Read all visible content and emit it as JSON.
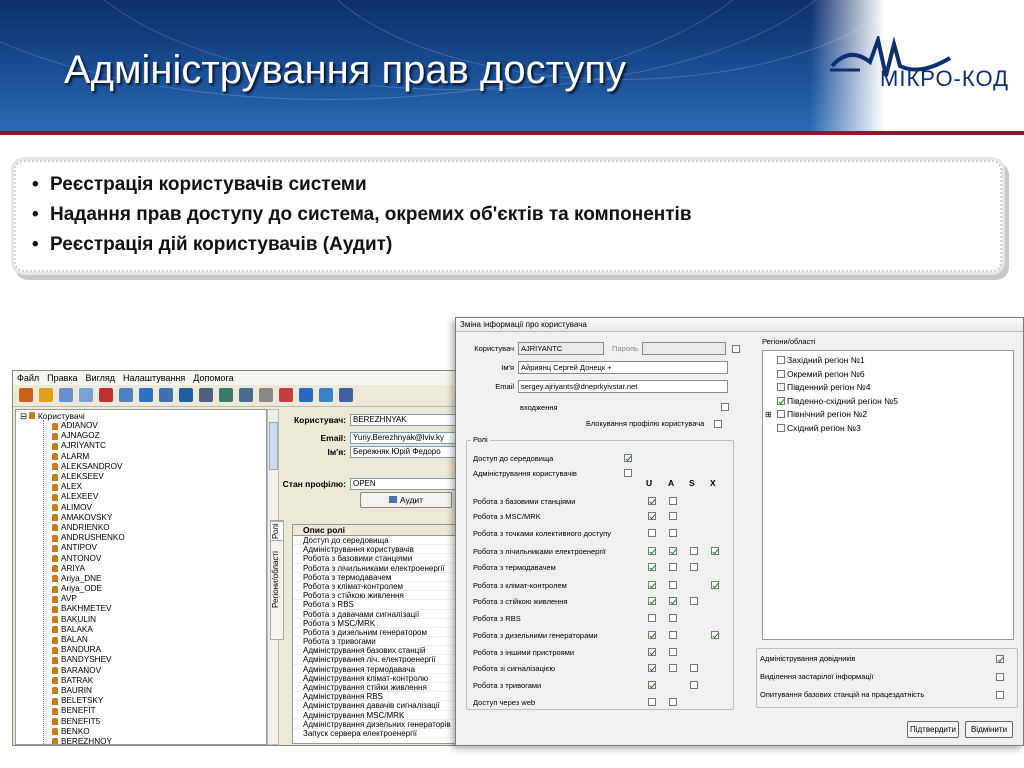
{
  "slide": {
    "title": "Адміністрування прав доступу",
    "logo_text": "МІКРО-КОД",
    "bullets": [
      "Реєстрація користувачів системи",
      "Надання прав доступу до система, окремих об'єктів та компонентів",
      "Реєстрація дій користувачів (Аудит)"
    ]
  },
  "main_window": {
    "menu": [
      "Файл",
      "Правка",
      "Вигляд",
      "Налаштування",
      "Допомога"
    ],
    "tree_root": "Користувачі",
    "users": [
      "ADIANOV",
      "AJNAGOZ",
      "AJRIYANTC",
      "ALARM",
      "ALEKSANDROV",
      "ALEKSEEV",
      "ALEX",
      "ALEXEEV",
      "ALIMOV",
      "AMAKOVSKY",
      "ANDRIENKO",
      "ANDRUSHENKO",
      "ANTIPOV",
      "ANTONOV",
      "ARIYA",
      "Ariya_DNE",
      "Ariya_ODE",
      "AVP",
      "BAKHMETEV",
      "BAKULIN",
      "BALAKA",
      "BALAN",
      "BANDURA",
      "BANDYSHEV",
      "BARANOV",
      "BATRAK",
      "BAURIN",
      "BELETSKY",
      "BENEFIT",
      "BENEFIT5",
      "BENKO",
      "BEREZHNOY"
    ],
    "form": {
      "user_label": "Користувач:",
      "user_value": "BEREZHNYAK",
      "email_label": "Email:",
      "email_value": "Yuriy.Berezhnyak@lviv.ky",
      "name_label": "Ім'я:",
      "name_value": "Бережняк Юрій Федоро",
      "profile_label": "Стан профілю:",
      "profile_value": "OPEN",
      "audit_button": "Аудит"
    },
    "tab_roles": "Ролі",
    "tab_regions": "Регіони/області",
    "roles_header": "Опис ролі",
    "roles": [
      "Доступ до середовища",
      "Адміністрування користувачів",
      "Робота з базовими станціями",
      "Робота з лічильниками електроенергії",
      "Робота з термодавачем",
      "Робота з клімат-контролем",
      "Робота з стійкою живлення",
      "Робота з RBS",
      "Робота з давачами сигналізації",
      "Робота з MSC/MRK",
      "Робота з дизельним генератором",
      "Робота з тривогами",
      "Адміністрування базових станцій",
      "Адміністрування ліч. електроенергії",
      "Адміністрування термодавача",
      "Адміністрування клімат-контролю",
      "Адміністрування стійки живлення",
      "Адміністрування RBS",
      "Адміністрування давачів сигналізації",
      "Адміністрування MSC/MRK",
      "Адміністрування дизельних генераторів",
      "Запуск сервера електроенергії"
    ]
  },
  "dialog": {
    "caption": "Зміна інформації про користувача",
    "user_label": "Користувач",
    "user_value": "AJRIYANTC",
    "password_label": "Пароль",
    "name_label": "Ім'я",
    "name_value": "Айриянц Сергей Донецк +",
    "email_label": "Email",
    "email_value": "sergey.ajriyants@dneprkyivstar.net",
    "entry_label": "входження",
    "block_label": "Блокування профілю користувача",
    "roles_group": "Ролі",
    "columns": [
      "U",
      "A",
      "S",
      "X"
    ],
    "role_rows": [
      {
        "name": "Доступ до середовища",
        "checks": [
          true
        ]
      },
      {
        "name": "Адміністрування користувачів",
        "checks": [
          false
        ]
      },
      {
        "name": "Робота з базовими станціями",
        "checks": [
          true,
          false
        ]
      },
      {
        "name": "Робота з MSC/MRK",
        "checks": [
          true,
          false
        ]
      },
      {
        "name": "Робота з точками колективного доступу",
        "checks": [
          false,
          false
        ]
      },
      {
        "name": "Робота з лічильниками електроенергії",
        "checks": [
          true,
          true,
          false,
          true
        ]
      },
      {
        "name": "Робота з термодавачем",
        "checks": [
          true,
          false,
          false
        ]
      },
      {
        "name": "Робота з клімат-контролем",
        "checks": [
          true,
          false,
          null,
          true
        ]
      },
      {
        "name": "Робота з стійкою живлення",
        "checks": [
          true,
          true,
          false
        ]
      },
      {
        "name": "Робота з RBS",
        "checks": [
          false,
          false
        ]
      },
      {
        "name": "Робота з дизельними генераторами",
        "checks": [
          true,
          false,
          null,
          true
        ]
      },
      {
        "name": "Робота з іншими пристроями",
        "checks": [
          true,
          false
        ]
      },
      {
        "name": "Робота зі сигналізацією",
        "checks": [
          true,
          false,
          false
        ]
      },
      {
        "name": "Робота з тривогами",
        "checks": [
          true,
          null,
          false
        ]
      },
      {
        "name": "Доступ через web",
        "checks": [
          false,
          false
        ]
      }
    ],
    "regions_group": "Регіони/області",
    "regions": [
      {
        "name": "Західний регіон №1",
        "checked": false,
        "expand": false
      },
      {
        "name": "Окремий регіон №6",
        "checked": false,
        "expand": false
      },
      {
        "name": "Південний регіон №4",
        "checked": false,
        "expand": false
      },
      {
        "name": "Південно-східний регіон №5",
        "checked": true,
        "expand": false
      },
      {
        "name": "Північний регіон №2",
        "checked": false,
        "expand": true
      },
      {
        "name": "Східний регіон №3",
        "checked": false,
        "expand": false
      }
    ],
    "options": [
      {
        "label": "Адміністрування довідників",
        "checked": true
      },
      {
        "label": "Виділення застарілої інформації",
        "checked": false
      },
      {
        "label": "Опитування базових станцій на працездатність",
        "checked": false
      }
    ],
    "ok_button": "Підтвердити",
    "cancel_button": "Відмінити"
  }
}
